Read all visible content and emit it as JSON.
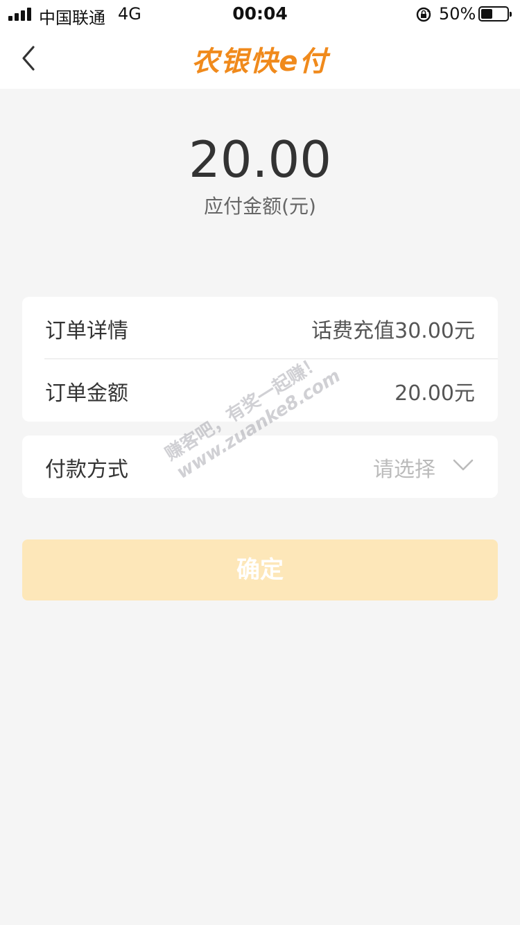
{
  "status_bar": {
    "carrier": "中国联通",
    "network": "4G",
    "time": "00:04",
    "battery_percent": "50%"
  },
  "nav": {
    "brand": "农银快e付"
  },
  "payment": {
    "amount": "20.00",
    "amount_label": "应付金额(元)"
  },
  "order": {
    "detail_label": "订单详情",
    "detail_value": "话费充值30.00元",
    "amount_label": "订单金额",
    "amount_value": "20.00元"
  },
  "pay_method": {
    "label": "付款方式",
    "placeholder": "请选择"
  },
  "confirm_label": "确定",
  "watermark": {
    "line1": "赚客吧，有奖一起赚！",
    "line2": "www.zuanke8.com"
  },
  "colors": {
    "brand": "#f08a1c",
    "confirm_bg": "#fde7b9",
    "page_bg": "#f5f5f5"
  },
  "icons": [
    "signal-icon",
    "lock-rotation-icon",
    "battery-icon",
    "back-chevron-icon",
    "chevron-down-icon"
  ]
}
